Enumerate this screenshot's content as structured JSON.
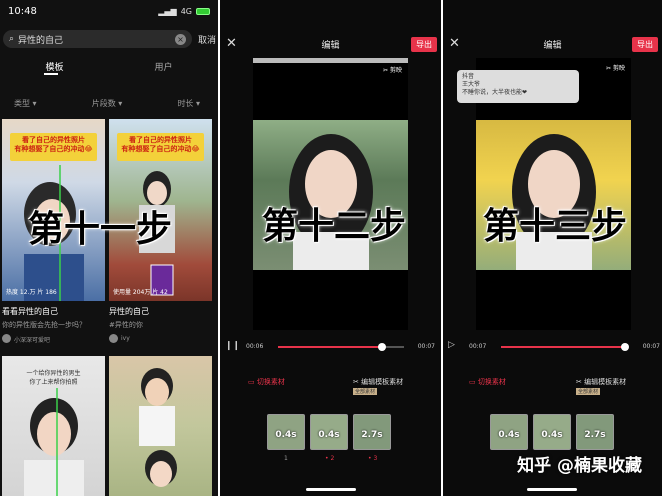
{
  "status": {
    "time": "10:48",
    "network": "4G"
  },
  "search": {
    "query": "异性的自己",
    "cancel": "取消"
  },
  "tabs": [
    "模板",
    "用户"
  ],
  "filters": [
    "类型",
    "片段数",
    "时长"
  ],
  "cards": [
    {
      "banner": "看了自己的异性照片\n有种想娶了自己的冲动😂",
      "title": "看看异性的自己",
      "sub": "你的异性版会先抢一步吗？",
      "author": "小深深可爱吧",
      "meta": "热度 12.万 片 186"
    },
    {
      "banner": "看了自己的异性照片\n有种想娶了自己的冲动😂",
      "title": "异性的自己",
      "sub": "#异性的你",
      "author": "ivy",
      "meta": "使用量 204万 片 42"
    },
    {
      "banner": "一个给你异性的男生\n你了上来帮你拍照",
      "title": "",
      "sub": "",
      "author": "",
      "meta": ""
    }
  ],
  "steps": [
    "第十一步",
    "第十二步",
    "第十三步"
  ],
  "editor2": {
    "title": "编辑",
    "export": "导出",
    "time_start": "00:06",
    "time_end": "00:07",
    "logo": "剪映",
    "tool_left": "切换素材",
    "tool_right": "编辑模板素材",
    "tool_tag": "全部素材",
    "clips": [
      "0.4s",
      "0.4s",
      "2.7s"
    ],
    "clip_nums": [
      "1",
      "2",
      "3"
    ]
  },
  "editor3": {
    "title": "编辑",
    "export": "导出",
    "time_start": "00:07",
    "time_end": "00:07",
    "logo": "剪映",
    "tool_left": "切换素材",
    "tool_right": "编辑模板素材",
    "tool_tag": "全部素材",
    "clips": [
      "0.4s",
      "0.4s",
      "2.7s"
    ],
    "notif_line1": "抖音",
    "notif_line2": "王大爷",
    "notif_line3": "不睡你说，大半夜也能❤"
  },
  "watermark": "知乎 @楠果收藏",
  "colors": {
    "accent": "#e8334a",
    "banner": "#f3d13a"
  }
}
